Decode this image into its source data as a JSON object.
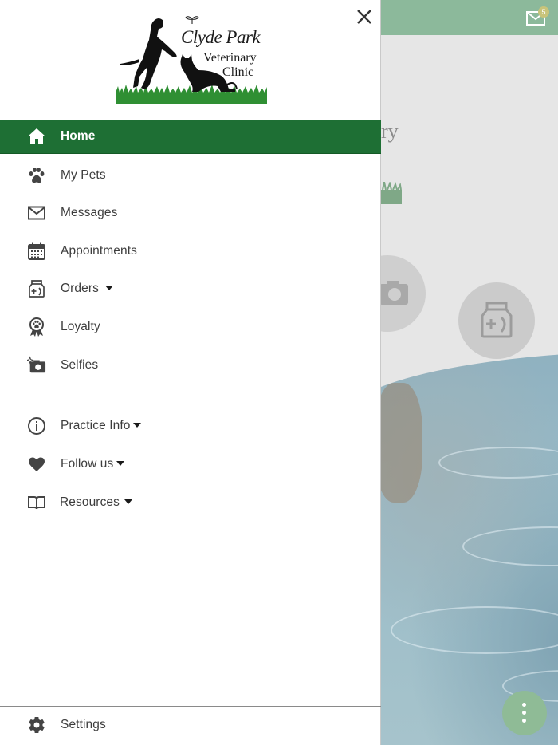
{
  "app": {
    "logo": {
      "line1": "Clyde Park",
      "line2": "Veterinary",
      "line3": "Clinic"
    }
  },
  "drawer": {
    "close_icon": "close-icon",
    "nav": {
      "home": {
        "label": "Home",
        "icon": "home-icon",
        "active": true
      },
      "my_pets": {
        "label": "My Pets",
        "icon": "paw-icon"
      },
      "messages": {
        "label": "Messages",
        "icon": "mail-icon"
      },
      "appointments": {
        "label": "Appointments",
        "icon": "calendar-icon"
      },
      "orders": {
        "label": "Orders",
        "icon": "pet-food-bag-icon",
        "has_dropdown": true
      },
      "loyalty": {
        "label": "Loyalty",
        "icon": "paw-award-ribbon-icon"
      },
      "selfies": {
        "label": "Selfies",
        "icon": "camera-sparkle-icon"
      },
      "practice_info": {
        "label": "Practice Info",
        "icon": "info-icon",
        "has_dropdown": true
      },
      "follow_us": {
        "label": "Follow us",
        "icon": "heart-icon",
        "has_dropdown": true
      },
      "resources": {
        "label": "Resources",
        "icon": "book-icon",
        "has_dropdown": true
      },
      "settings": {
        "label": "Settings",
        "icon": "gear-icon"
      }
    }
  },
  "background": {
    "header_color": "#8cb99b",
    "mail_badge": "5",
    "logo_fragment": "ry",
    "fab_icon": "more-vertical-icon"
  },
  "colors": {
    "active_item_bg": "#1e6f34",
    "icon_color": "#3d3d3d",
    "text_color": "#3d3d3d"
  }
}
